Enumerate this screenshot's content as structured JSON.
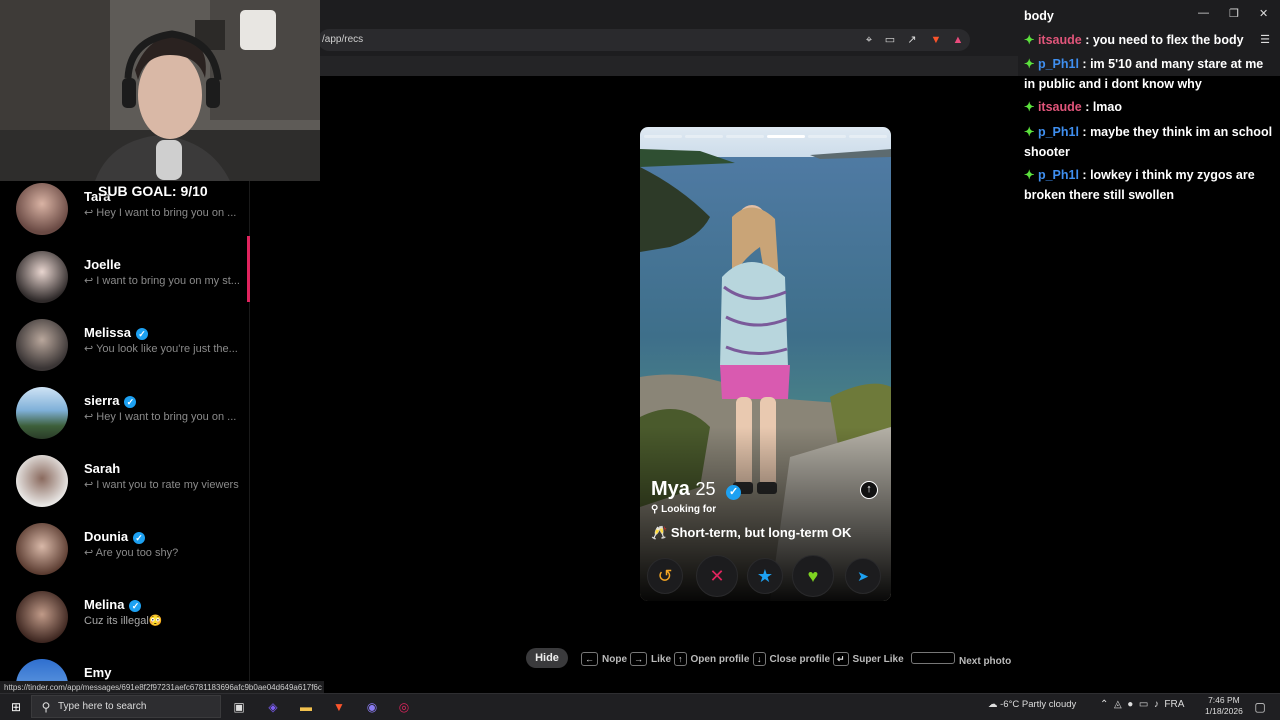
{
  "browser": {
    "url": "/app/recs",
    "status_url": "https://tinder.com/app/messages/691e8f2f97231aefc6781183696afc9b0ae04d649a617f6c"
  },
  "overlay": {
    "sub_goal": "SUB GOAL: 9/10"
  },
  "sidebar": {
    "conversations": [
      {
        "name": "Tara",
        "preview": "Hey I want to bring you on ...",
        "verified": false
      },
      {
        "name": "Joelle",
        "preview": "I want to bring you on my st...",
        "verified": false
      },
      {
        "name": "Melissa",
        "preview": "You look like you're just the...",
        "verified": true
      },
      {
        "name": "sierra",
        "preview": "Hey I want to bring you on ...",
        "verified": true
      },
      {
        "name": "Sarah",
        "preview": "I want you to rate my viewers",
        "verified": false
      },
      {
        "name": "Dounia",
        "preview": "Are you too shy?",
        "verified": true
      },
      {
        "name": "Melina",
        "preview": "Cuz its illegal😳",
        "verified": true
      },
      {
        "name": "Emy",
        "preview": "",
        "verified": false
      }
    ]
  },
  "profile": {
    "name": "Mya",
    "age": "25",
    "looking_for_label": "Looking for",
    "looking_for_value": "Short-term, but long-term OK",
    "looking_for_emoji": "🥂"
  },
  "actions": {
    "rewind": "↺",
    "nope": "✕",
    "super_like": "★",
    "like": "♥",
    "boost": "➤"
  },
  "hints": {
    "hide": "Hide",
    "nope": "Nope",
    "like": "Like",
    "open_profile": "Open profile",
    "close_profile": "Close profile",
    "super_like": "Super Like",
    "next_photo": "Next photo"
  },
  "chat": {
    "messages": [
      {
        "user": "",
        "text": "body"
      },
      {
        "user": "itsaude",
        "text": "you need to flex the body",
        "color": "#e0557a"
      },
      {
        "user": "p_Ph1l",
        "text": "im 5'10 and many stare at me in public and i dont know why",
        "color": "#3f8ff0"
      },
      {
        "user": "itsaude",
        "text": "lmao",
        "color": "#e0557a"
      },
      {
        "user": "p_Ph1l",
        "text": "maybe they think im an school shooter",
        "color": "#3f8ff0"
      },
      {
        "user": "p_Ph1l",
        "text": "lowkey i think my zygos are broken there still swollen",
        "color": "#3f8ff0"
      }
    ]
  },
  "taskbar": {
    "search_placeholder": "Type here to search",
    "weather": "-6°C  Partly cloudy",
    "lang": "FRA",
    "time": "7:46 PM",
    "date": "1/18/2026"
  },
  "colors": {
    "nope": "#e0245e",
    "like": "#7ed321",
    "super": "#1da1f2",
    "rewind": "#f5a623",
    "boost": "#1da1f2"
  }
}
